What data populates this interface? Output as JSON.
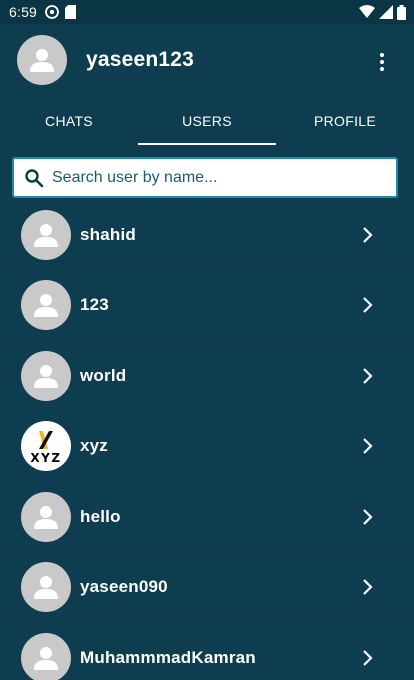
{
  "status_bar": {
    "time": "6:59"
  },
  "header": {
    "username": "yaseen123"
  },
  "tabs": [
    {
      "label": "CHATS",
      "active": false
    },
    {
      "label": "USERS",
      "active": true
    },
    {
      "label": "PROFILE",
      "active": false
    }
  ],
  "search": {
    "placeholder": "Search user by name..."
  },
  "users": [
    {
      "name": "shahid",
      "avatar": "person-icon"
    },
    {
      "name": "123",
      "avatar": "person-icon"
    },
    {
      "name": "world",
      "avatar": "person-icon"
    },
    {
      "name": "xyz",
      "avatar": "xyz-logo",
      "logo_text": "XYZ"
    },
    {
      "name": "hello",
      "avatar": "person-icon"
    },
    {
      "name": "yaseen090",
      "avatar": "person-icon"
    },
    {
      "name": "MuhammmadKamran",
      "avatar": "person-icon"
    }
  ],
  "colors": {
    "background": "#0d3d4f",
    "accent": "#1a8fa6",
    "avatar_placeholder": "#c9c9c9"
  }
}
